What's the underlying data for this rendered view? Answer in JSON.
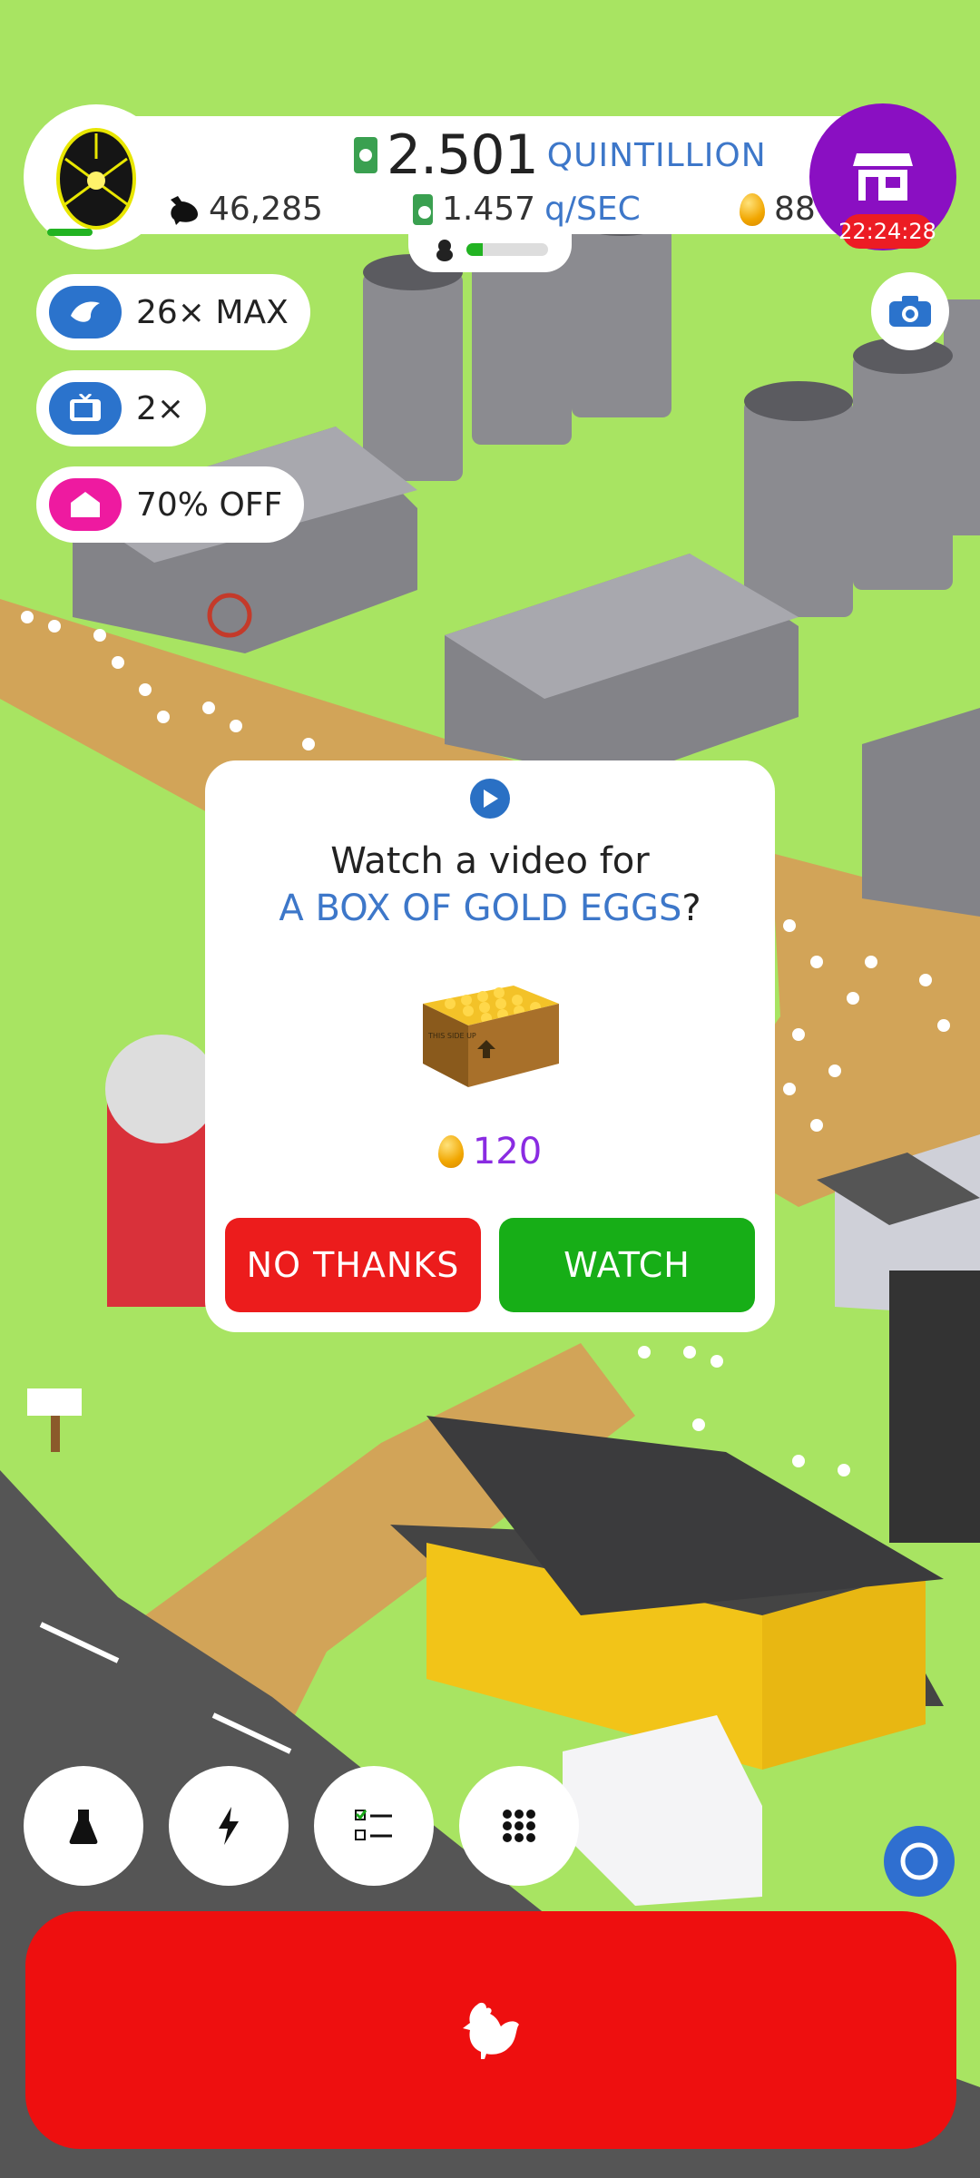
{
  "hud": {
    "money_value": "2.501",
    "money_unit": "QUINTILLION",
    "rate_value": "1.457",
    "rate_unit": "q/SEC",
    "chicken_count": "46,285",
    "gold_eggs": "88",
    "shop_timer": "22:24:28",
    "hatchery_progress_percent": 20
  },
  "boosts": {
    "chicken_boost": "26× MAX",
    "video_boost": "2×",
    "discount": "70% OFF"
  },
  "modal": {
    "line1": "Watch a video for",
    "line2": "A BOX OF GOLD EGGS",
    "line2_suffix": "?",
    "crate_label": "THIS SIDE UP",
    "reward_amount": "120",
    "no_label": "NO THANKS",
    "watch_label": "WATCH"
  },
  "icons": {
    "egg_badge": "glowing-egg-icon",
    "shop": "shop-icon",
    "camera": "camera-icon",
    "research": "flask-icon",
    "boost": "lightning-icon",
    "missions": "checklist-icon",
    "menu": "grid-icon",
    "hatch": "chicken-icon"
  },
  "colors": {
    "grass": "#a8e462",
    "shop": "#8a0fc2",
    "red": "#ec1c1c",
    "green": "#17ae17",
    "blue_text": "#3d77c9"
  }
}
